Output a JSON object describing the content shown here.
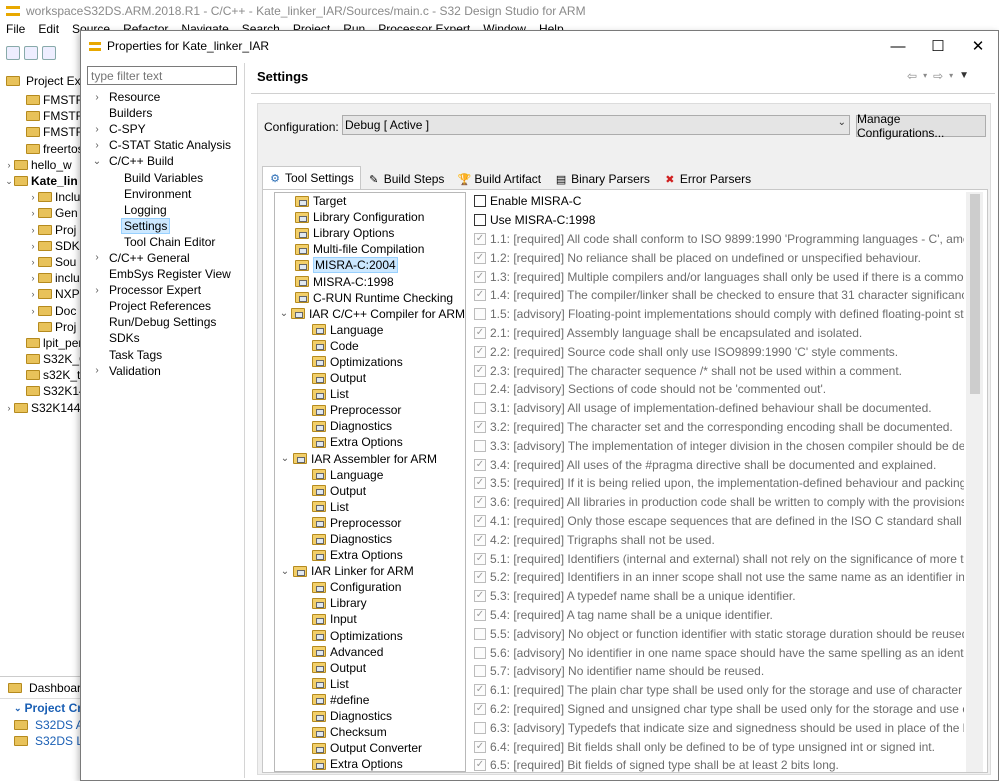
{
  "ide": {
    "title": "workspaceS32DS.ARM.2018.R1 - C/C++ - Kate_linker_IAR/Sources/main.c - S32 Design Studio for ARM",
    "menu": [
      "File",
      "Edit",
      "Source",
      "Refactor",
      "Navigate",
      "Search",
      "Project",
      "Run",
      "Processor Expert",
      "Window",
      "Help"
    ],
    "explorer_tab": "Project Expl",
    "explorer_items": [
      {
        "label": "FMSTR_",
        "indent": 1,
        "arrow": "",
        "bold": false
      },
      {
        "label": "FMSTR_",
        "indent": 1,
        "arrow": "",
        "bold": false
      },
      {
        "label": "FMSTR_",
        "indent": 1,
        "arrow": "",
        "bold": false
      },
      {
        "label": "freertos",
        "indent": 1,
        "arrow": "",
        "bold": false
      },
      {
        "label": "hello_w",
        "indent": 0,
        "arrow": "›",
        "bold": false
      },
      {
        "label": "Kate_lin",
        "indent": 0,
        "arrow": "⌄",
        "bold": true
      },
      {
        "label": "Inclu",
        "indent": 2,
        "arrow": "›",
        "bold": false
      },
      {
        "label": "Gen",
        "indent": 2,
        "arrow": "›",
        "bold": false
      },
      {
        "label": "Proj",
        "indent": 2,
        "arrow": "›",
        "bold": false
      },
      {
        "label": "SDK",
        "indent": 2,
        "arrow": "›",
        "bold": false
      },
      {
        "label": "Sou",
        "indent": 2,
        "arrow": "›",
        "bold": false
      },
      {
        "label": "inclu",
        "indent": 2,
        "arrow": "›",
        "bold": false
      },
      {
        "label": "NXP",
        "indent": 2,
        "arrow": "›",
        "bold": false
      },
      {
        "label": "Doc",
        "indent": 2,
        "arrow": "›",
        "bold": false
      },
      {
        "label": "Proj",
        "indent": 2,
        "arrow": "",
        "bold": false
      },
      {
        "label": "lpit_per",
        "indent": 1,
        "arrow": "",
        "bold": false
      },
      {
        "label": "S32K_C",
        "indent": 1,
        "arrow": "",
        "bold": false
      },
      {
        "label": "s32K_te",
        "indent": 1,
        "arrow": "",
        "bold": false
      },
      {
        "label": "S32K144",
        "indent": 1,
        "arrow": "",
        "bold": false
      },
      {
        "label": "S32K144",
        "indent": 0,
        "arrow": "›",
        "bold": false
      }
    ],
    "dashboard_tab": "Dashboard",
    "dashboard_heading": "Project Cre",
    "dashboard_items": [
      "S32DS Ap",
      "S32DS Lib"
    ]
  },
  "dialog": {
    "title": "Properties for Kate_linker_IAR",
    "filter_placeholder": "type filter text",
    "nav": [
      {
        "label": "Resource",
        "arrow": "›",
        "child": false,
        "selected": false
      },
      {
        "label": "Builders",
        "arrow": "",
        "child": false,
        "selected": false
      },
      {
        "label": "C-SPY",
        "arrow": "›",
        "child": false,
        "selected": false
      },
      {
        "label": "C-STAT Static Analysis",
        "arrow": "›",
        "child": false,
        "selected": false
      },
      {
        "label": "C/C++ Build",
        "arrow": "⌄",
        "child": false,
        "selected": false
      },
      {
        "label": "Build Variables",
        "arrow": "",
        "child": true,
        "selected": false
      },
      {
        "label": "Environment",
        "arrow": "",
        "child": true,
        "selected": false
      },
      {
        "label": "Logging",
        "arrow": "",
        "child": true,
        "selected": false
      },
      {
        "label": "Settings",
        "arrow": "",
        "child": true,
        "selected": true
      },
      {
        "label": "Tool Chain Editor",
        "arrow": "",
        "child": true,
        "selected": false
      },
      {
        "label": "C/C++ General",
        "arrow": "›",
        "child": false,
        "selected": false
      },
      {
        "label": "EmbSys Register View",
        "arrow": "",
        "child": false,
        "selected": false
      },
      {
        "label": "Processor Expert",
        "arrow": "›",
        "child": false,
        "selected": false
      },
      {
        "label": "Project References",
        "arrow": "",
        "child": false,
        "selected": false
      },
      {
        "label": "Run/Debug Settings",
        "arrow": "",
        "child": false,
        "selected": false
      },
      {
        "label": "SDKs",
        "arrow": "",
        "child": false,
        "selected": false
      },
      {
        "label": "Task Tags",
        "arrow": "",
        "child": false,
        "selected": false
      },
      {
        "label": "Validation",
        "arrow": "›",
        "child": false,
        "selected": false
      }
    ],
    "page_title": "Settings",
    "configuration_label": "Configuration:",
    "configuration_value": "Debug  [ Active ]",
    "manage_button": "Manage Configurations...",
    "tabs": [
      {
        "label": "Tool Settings",
        "icon": "tool-settings-icon",
        "glyph": "⚙",
        "active": true
      },
      {
        "label": "Build Steps",
        "icon": "build-steps-icon",
        "glyph": "✎",
        "active": false
      },
      {
        "label": "Build Artifact",
        "icon": "build-artifact-icon",
        "glyph": "🏆",
        "active": false
      },
      {
        "label": "Binary Parsers",
        "icon": "binary-parsers-icon",
        "glyph": "▤",
        "active": false
      },
      {
        "label": "Error Parsers",
        "icon": "error-parsers-icon",
        "glyph": "✖",
        "active": false
      }
    ],
    "tool_tree": [
      {
        "label": "Target",
        "level": 1,
        "expander": "",
        "selected": false
      },
      {
        "label": "Library Configuration",
        "level": 1,
        "expander": "",
        "selected": false
      },
      {
        "label": "Library Options",
        "level": 1,
        "expander": "",
        "selected": false
      },
      {
        "label": "Multi-file Compilation",
        "level": 1,
        "expander": "",
        "selected": false
      },
      {
        "label": "MISRA-C:2004",
        "level": 1,
        "expander": "",
        "selected": true
      },
      {
        "label": "MISRA-C:1998",
        "level": 1,
        "expander": "",
        "selected": false
      },
      {
        "label": "C-RUN Runtime Checking",
        "level": 1,
        "expander": "",
        "selected": false
      },
      {
        "label": "IAR C/C++ Compiler for ARM",
        "level": 0,
        "expander": "⌄",
        "selected": false
      },
      {
        "label": "Language",
        "level": 2,
        "expander": "",
        "selected": false
      },
      {
        "label": "Code",
        "level": 2,
        "expander": "",
        "selected": false
      },
      {
        "label": "Optimizations",
        "level": 2,
        "expander": "",
        "selected": false
      },
      {
        "label": "Output",
        "level": 2,
        "expander": "",
        "selected": false
      },
      {
        "label": "List",
        "level": 2,
        "expander": "",
        "selected": false
      },
      {
        "label": "Preprocessor",
        "level": 2,
        "expander": "",
        "selected": false
      },
      {
        "label": "Diagnostics",
        "level": 2,
        "expander": "",
        "selected": false
      },
      {
        "label": "Extra Options",
        "level": 2,
        "expander": "",
        "selected": false
      },
      {
        "label": "IAR Assembler for ARM",
        "level": 0,
        "expander": "⌄",
        "selected": false
      },
      {
        "label": "Language",
        "level": 2,
        "expander": "",
        "selected": false
      },
      {
        "label": "Output",
        "level": 2,
        "expander": "",
        "selected": false
      },
      {
        "label": "List",
        "level": 2,
        "expander": "",
        "selected": false
      },
      {
        "label": "Preprocessor",
        "level": 2,
        "expander": "",
        "selected": false
      },
      {
        "label": "Diagnostics",
        "level": 2,
        "expander": "",
        "selected": false
      },
      {
        "label": "Extra Options",
        "level": 2,
        "expander": "",
        "selected": false
      },
      {
        "label": "IAR Linker for ARM",
        "level": 0,
        "expander": "⌄",
        "selected": false
      },
      {
        "label": "Configuration",
        "level": 2,
        "expander": "",
        "selected": false
      },
      {
        "label": "Library",
        "level": 2,
        "expander": "",
        "selected": false
      },
      {
        "label": "Input",
        "level": 2,
        "expander": "",
        "selected": false
      },
      {
        "label": "Optimizations",
        "level": 2,
        "expander": "",
        "selected": false
      },
      {
        "label": "Advanced",
        "level": 2,
        "expander": "",
        "selected": false
      },
      {
        "label": "Output",
        "level": 2,
        "expander": "",
        "selected": false
      },
      {
        "label": "List",
        "level": 2,
        "expander": "",
        "selected": false
      },
      {
        "label": "#define",
        "level": 2,
        "expander": "",
        "selected": false
      },
      {
        "label": "Diagnostics",
        "level": 2,
        "expander": "",
        "selected": false
      },
      {
        "label": "Checksum",
        "level": 2,
        "expander": "",
        "selected": false
      },
      {
        "label": "Output Converter",
        "level": 2,
        "expander": "",
        "selected": false
      },
      {
        "label": "Extra Options",
        "level": 2,
        "expander": "",
        "selected": false
      }
    ],
    "misra_options": [
      {
        "text": "Enable MISRA-C",
        "checked": false,
        "enabled": true
      },
      {
        "text": "Use MISRA-C:1998",
        "checked": false,
        "enabled": true
      },
      {
        "text": "1.1: [required] All code shall conform to ISO 9899:1990 'Programming languages - C', amended and c",
        "checked": true,
        "enabled": false
      },
      {
        "text": "1.2: [required] No reliance shall be placed on undefined or unspecified behaviour.",
        "checked": true,
        "enabled": false
      },
      {
        "text": "1.3: [required] Multiple compilers and/or languages shall only be used if there is a common defined in",
        "checked": true,
        "enabled": false
      },
      {
        "text": "1.4: [required] The compiler/linker shall be checked to ensure that 31 character significance and case",
        "checked": true,
        "enabled": false
      },
      {
        "text": "1.5: [advisory] Floating-point implementations should comply with defined floating-point standards.",
        "checked": false,
        "enabled": false
      },
      {
        "text": "2.1: [required] Assembly language shall be encapsulated and isolated.",
        "checked": true,
        "enabled": false
      },
      {
        "text": "2.2: [required] Source code shall only use ISO9899:1990 'C' style comments.",
        "checked": true,
        "enabled": false
      },
      {
        "text": "2.3: [required] The character sequence /* shall not be used within a comment.",
        "checked": true,
        "enabled": false
      },
      {
        "text": "2.4: [advisory] Sections of code should not be 'commented out'.",
        "checked": false,
        "enabled": false
      },
      {
        "text": "3.1: [advisory] All usage of implementation-defined behaviour shall be documented.",
        "checked": false,
        "enabled": false
      },
      {
        "text": "3.2: [required] The character set and the corresponding encoding shall be documented.",
        "checked": true,
        "enabled": false
      },
      {
        "text": "3.3: [advisory] The implementation of integer division in the chosen compiler should be determined,",
        "checked": false,
        "enabled": false
      },
      {
        "text": "3.4: [required] All uses of the #pragma directive shall be documented and explained.",
        "checked": true,
        "enabled": false
      },
      {
        "text": "3.5: [required] If it is being relied upon, the implementation-defined behaviour and packing of birfield",
        "checked": true,
        "enabled": false
      },
      {
        "text": "3.6: [required] All libraries in production code shall be written to comply with the provisions of this do",
        "checked": true,
        "enabled": false
      },
      {
        "text": "4.1: [required] Only those escape sequences that are defined in the ISO C standard shall be used.",
        "checked": true,
        "enabled": false
      },
      {
        "text": "4.2: [required] Trigraphs shall not be used.",
        "checked": true,
        "enabled": false
      },
      {
        "text": "5.1: [required] Identifiers (internal and external) shall not rely on the significance of more than 31 char",
        "checked": true,
        "enabled": false
      },
      {
        "text": "5.2: [required] Identifiers in an inner scope shall not use the same name as an identifier in an outer sco",
        "checked": true,
        "enabled": false
      },
      {
        "text": "5.3: [required] A typedef name shall be a unique identifier.",
        "checked": true,
        "enabled": false
      },
      {
        "text": "5.4: [required] A tag name shall be a unique identifier.",
        "checked": true,
        "enabled": false
      },
      {
        "text": "5.5: [advisory] No object or function identifier with static storage duration should be reused.",
        "checked": false,
        "enabled": false
      },
      {
        "text": "5.6: [advisory] No identifier in one name space should have the same spelling as an identifier in anoth",
        "checked": false,
        "enabled": false
      },
      {
        "text": "5.7: [advisory] No identifier name should be reused.",
        "checked": false,
        "enabled": false
      },
      {
        "text": "6.1: [required] The plain char type shall be used only for the storage and use of character values.",
        "checked": true,
        "enabled": false
      },
      {
        "text": "6.2: [required] Signed and unsigned char type shall be used only for the storage and use of numeric v",
        "checked": true,
        "enabled": false
      },
      {
        "text": "6.3: [advisory] Typedefs that indicate size and signedness should be used in place of the basic types.",
        "checked": false,
        "enabled": false
      },
      {
        "text": "6.4: [required] Bit fields shall only be defined to be of type unsigned int or signed int.",
        "checked": true,
        "enabled": false
      },
      {
        "text": "6.5: [required] Bit fields of signed type shall be at least 2 bits long.",
        "checked": true,
        "enabled": false
      }
    ]
  }
}
